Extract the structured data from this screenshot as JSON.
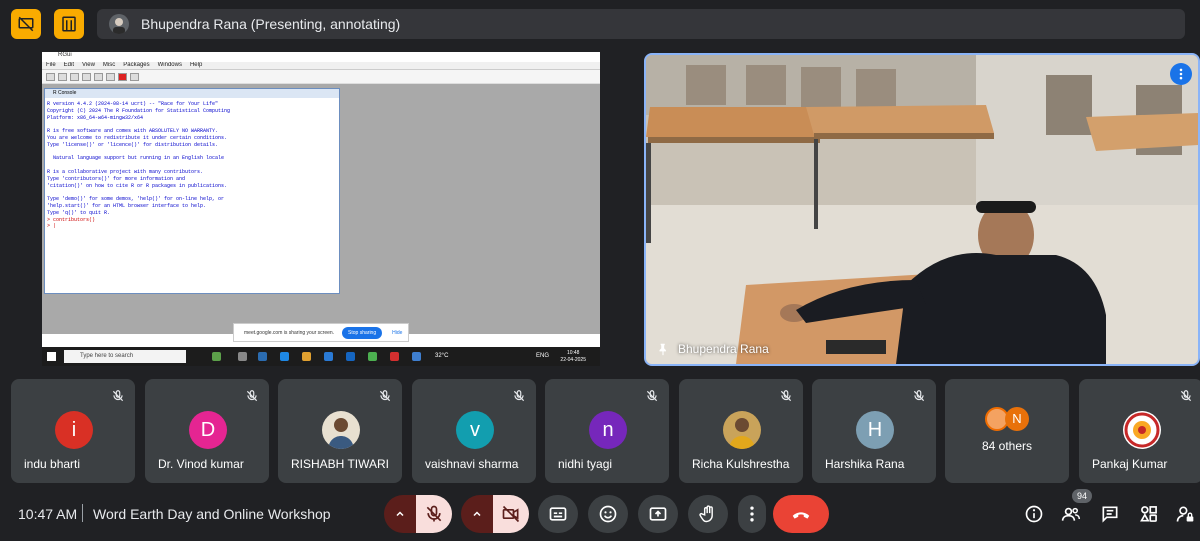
{
  "topbar": {
    "presenter_label": "Bhupendra Rana (Presenting, annotating)",
    "accent": "#f9ab00"
  },
  "shared_screen": {
    "window_title": "RGui",
    "menu": [
      "File",
      "Edit",
      "View",
      "Misc",
      "Packages",
      "Windows",
      "Help"
    ],
    "console_title": "R Console",
    "console_lines": [
      "R version 4.4.2 (2024-08-14 ucrt) -- \"Race for Your Life\"",
      "Copyright (C) 2024 The R Foundation for Statistical Computing",
      "Platform: x86_64-w64-mingw32/x64",
      "",
      "R is free software and comes with ABSOLUTELY NO WARRANTY.",
      "You are welcome to redistribute it under certain conditions.",
      "Type 'license()' or 'licence()' for distribution details.",
      "",
      "  Natural language support but running in an English locale",
      "",
      "R is a collaborative project with many contributors.",
      "Type 'contributors()' for more information and",
      "'citation()' on how to cite R or R packages in publications.",
      "",
      "Type 'demo()' for some demos, 'help()' for on-line help, or",
      "'help.start()' for an HTML browser interface to help.",
      "Type 'q()' to quit R."
    ],
    "prompt_lines": [
      "> contributors()",
      "> |"
    ],
    "share_notice": "meet.google.com is sharing your screen.",
    "stop_sharing": "Stop sharing",
    "hide": "Hide",
    "taskbar_search": "Type here to search",
    "weather": "32°C",
    "tray_lang": "ENG",
    "tray_time": "10:48",
    "tray_date": "22-04-2025"
  },
  "camera": {
    "name": "Bhupendra Rana",
    "border_color": "#8ab4f8"
  },
  "participants": [
    {
      "name": "indu bharti",
      "initial": "i",
      "color": "#d93025",
      "type": "letter"
    },
    {
      "name": "Dr. Vinod kumar",
      "initial": "D",
      "color": "#e52592",
      "type": "letter"
    },
    {
      "name": "RISHABH TIWARI",
      "initial": "",
      "color": "#e8e0d0",
      "type": "photo"
    },
    {
      "name": "vaishnavi sharma",
      "initial": "v",
      "color": "#129eaf",
      "type": "letter"
    },
    {
      "name": "nidhi tyagi",
      "initial": "n",
      "color": "#7627bb",
      "type": "letter"
    },
    {
      "name": "Richa Kulshrestha",
      "initial": "",
      "color": "#c9a35a",
      "type": "photo"
    },
    {
      "name": "Harshika Rana",
      "initial": "H",
      "color": "#7d9fb3",
      "type": "letter"
    },
    {
      "name": "84 others",
      "initial": "N",
      "color": "#e8710a",
      "type": "others"
    },
    {
      "name": "Pankaj Kumar",
      "initial": "",
      "color": "#ffffff",
      "type": "logo"
    }
  ],
  "bottombar": {
    "time": "10:47 AM",
    "meeting_title": "Word Earth Day and Online Workshop",
    "people_count": "94"
  },
  "colors": {
    "background": "#202124",
    "tile": "#3c4043",
    "end_call": "#ea4335",
    "muted_bg": "#f9dedc"
  }
}
